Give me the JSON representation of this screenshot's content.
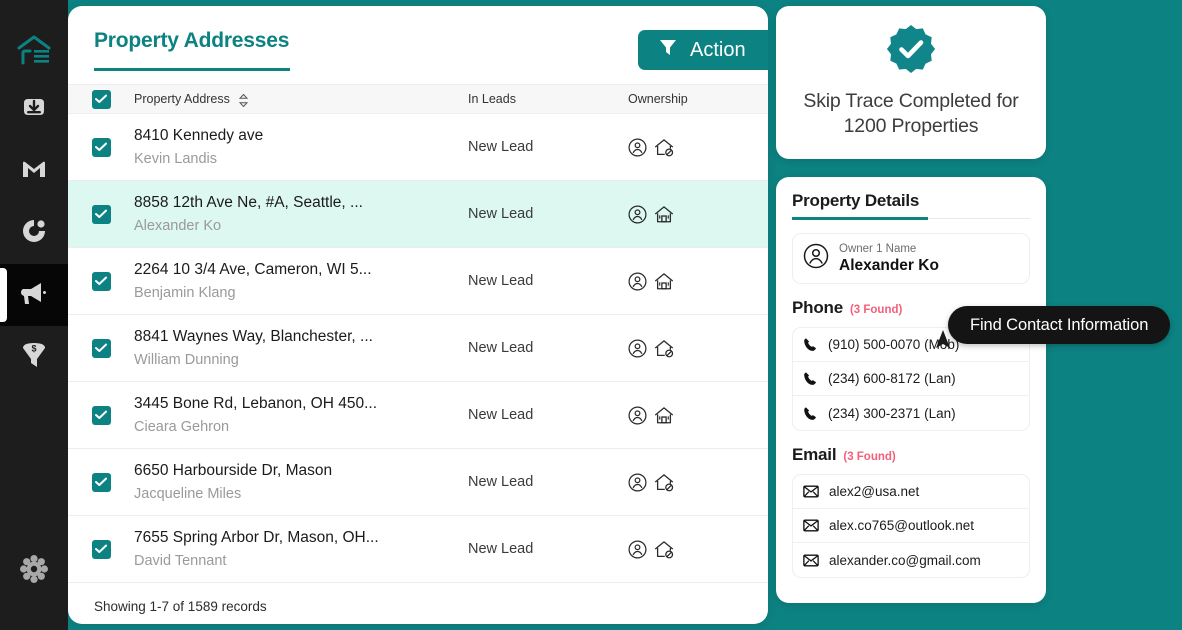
{
  "sidebar": {
    "logo": {
      "icon": "house-logo-icon",
      "alt": "RE logo"
    },
    "items": [
      {
        "icon": "import-download-icon",
        "name": "sidebar-item-import",
        "active": false
      },
      {
        "icon": "mail-m-icon",
        "name": "sidebar-item-mail",
        "active": false
      },
      {
        "icon": "target-circle-icon",
        "name": "sidebar-item-target",
        "active": false
      },
      {
        "icon": "megaphone-icon",
        "name": "sidebar-item-marketing",
        "active": true
      },
      {
        "icon": "money-funnel-icon",
        "name": "sidebar-item-deals",
        "active": false
      }
    ],
    "settings": {
      "icon": "gear-icon",
      "name": "sidebar-item-settings"
    }
  },
  "main": {
    "tab_label": "Property Addresses",
    "action_button": {
      "label": "Action",
      "icon": "filter-funnel-icon"
    },
    "table": {
      "columns": [
        "Property Address",
        "In Leads",
        "Ownership"
      ],
      "select_all_checked": true,
      "sort_icon": "sort-updown-icon",
      "rows": [
        {
          "address": "8410 Kennedy ave",
          "owner": "Kevin Landis",
          "lead": "New Lead",
          "checked": true,
          "selected": false,
          "ownership_icons": [
            "person-circle-icon",
            "house-absentee-icon"
          ]
        },
        {
          "address": "8858 12th Ave Ne, #A, Seattle, ...",
          "owner": "Alexander Ko",
          "lead": "New Lead",
          "checked": true,
          "selected": true,
          "ownership_icons": [
            "person-circle-icon",
            "house-occupied-icon"
          ]
        },
        {
          "address": "2264 10 3/4 Ave, Cameron, WI 5...",
          "owner": "Benjamin Klang",
          "lead": "New Lead",
          "checked": true,
          "selected": false,
          "ownership_icons": [
            "person-circle-icon",
            "house-occupied-icon"
          ]
        },
        {
          "address": "8841 Waynes Way, Blanchester, ...",
          "owner": "William Dunning",
          "lead": "New Lead",
          "checked": true,
          "selected": false,
          "ownership_icons": [
            "person-circle-icon",
            "house-absentee-icon"
          ]
        },
        {
          "address": "3445 Bone Rd, Lebanon, OH 450...",
          "owner": "Cieara Gehron",
          "lead": "New Lead",
          "checked": true,
          "selected": false,
          "ownership_icons": [
            "person-circle-icon",
            "house-occupied-icon"
          ]
        },
        {
          "address": "6650 Harbourside Dr, Mason",
          "owner": "Jacqueline Miles",
          "lead": "New Lead",
          "checked": true,
          "selected": false,
          "ownership_icons": [
            "person-circle-icon",
            "house-absentee-icon"
          ]
        },
        {
          "address": "7655 Spring Arbor Dr, Mason, OH...",
          "owner": "David Tennant",
          "lead": "New Lead",
          "checked": true,
          "selected": false,
          "ownership_icons": [
            "person-circle-icon",
            "house-absentee-icon"
          ]
        }
      ],
      "footer": "Showing 1-7 of 1589 records"
    }
  },
  "skip_trace_card": {
    "icon": "verified-check-badge-icon",
    "title": "Skip Trace Completed for 1200 Properties"
  },
  "property_details": {
    "title": "Property Details",
    "owner": {
      "icon": "person-circle-icon",
      "label": "Owner 1 Name",
      "value": "Alexander Ko"
    },
    "phone": {
      "heading": "Phone",
      "count": "(3 Found)",
      "items": [
        {
          "icon": "phone-icon",
          "value": "(910) 500-0070 (Mob)"
        },
        {
          "icon": "phone-icon",
          "value": "(234) 600-8172 (Lan)"
        },
        {
          "icon": "phone-icon",
          "value": "(234) 300-2371 (Lan)"
        }
      ]
    },
    "email": {
      "heading": "Email",
      "count": "(3 Found)",
      "items": [
        {
          "icon": "envelope-icon",
          "value": "alex2@usa.net"
        },
        {
          "icon": "envelope-icon",
          "value": "alex.co765@outlook.net"
        },
        {
          "icon": "envelope-icon",
          "value": "alexander.co@gmail.com"
        }
      ]
    }
  },
  "tooltip": {
    "label": "Find Contact Information"
  },
  "colors": {
    "brand_teal": "#0d8282",
    "sidebar_dark": "#1d1d1d",
    "selected_row": "#ddf7f1",
    "accent_pink": "#f2607b",
    "tooltip_black": "#141414"
  }
}
